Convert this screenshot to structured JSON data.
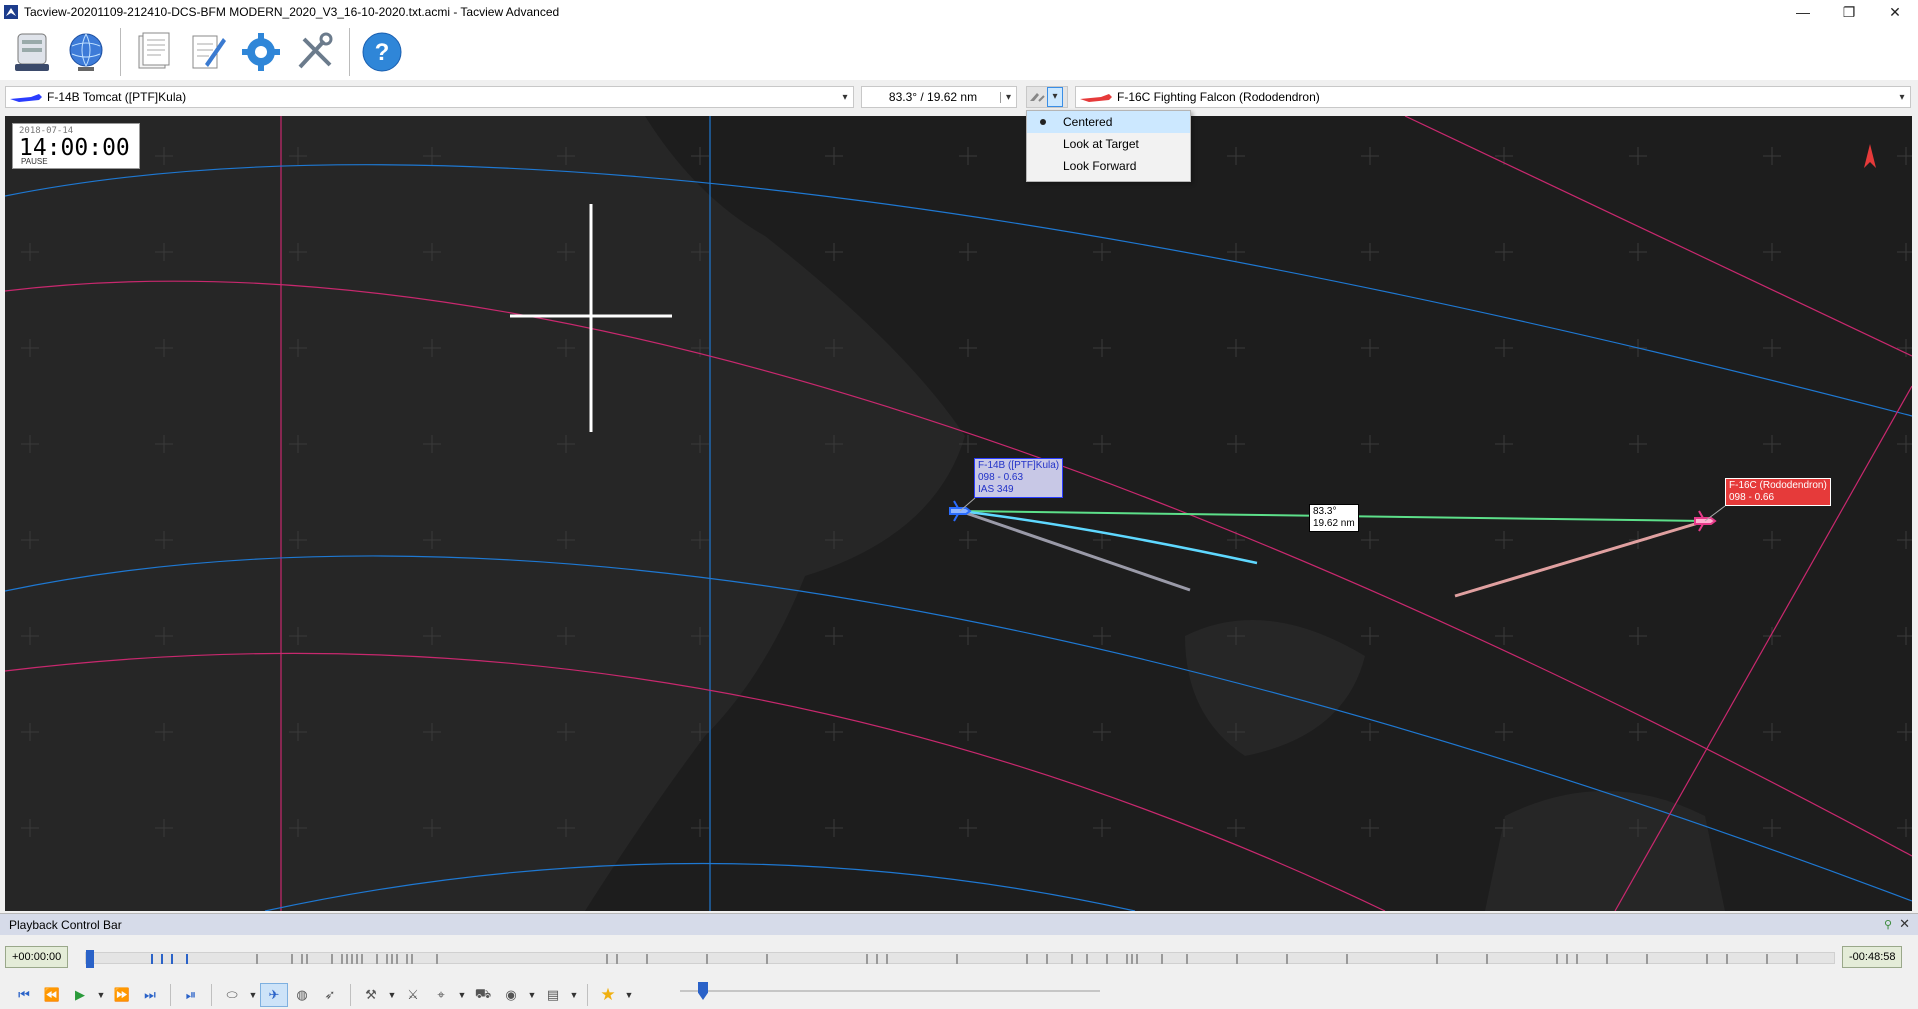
{
  "window": {
    "title": "Tacview-20201109-212410-DCS-BFM MODERN_2020_V3_16-10-2020.txt.acmi - Tacview Advanced",
    "minimize": "—",
    "restore": "❐",
    "close": "✕"
  },
  "toolbar": {
    "items": [
      "recorder-icon",
      "globe-icon",
      "documents-icon",
      "notepad-icon",
      "settings-gear-icon",
      "tools-icon",
      "help-icon"
    ]
  },
  "selectors": {
    "primary_object": "F-14B Tomcat ([PTF]Kula)",
    "bearing_range": "83.3° / 19.62 nm",
    "secondary_object": "F-16C Fighting Falcon (Rododendron)"
  },
  "camera_menu": {
    "items": [
      {
        "label": "Centered",
        "selected": true
      },
      {
        "label": "Look at Target",
        "selected": false
      },
      {
        "label": "Look Forward",
        "selected": false
      }
    ]
  },
  "clock": {
    "date": "2018-07-14",
    "time": "14:00:00",
    "state": "PAUSE"
  },
  "labels": {
    "f14": {
      "line1": "F-14B ([PTF]Kula)",
      "line2": "098 - 0.63",
      "line3": "IAS 349"
    },
    "f16": {
      "line1": "F-16C (Rododendron)",
      "line2": "098 - 0.66"
    },
    "range": {
      "line1": "83.3°",
      "line2": "19.62 nm"
    }
  },
  "colors": {
    "blue_coalition": "#2a3cff",
    "red_coalition": "#e63a3a",
    "grid_blue": "#1e78d2",
    "grid_magenta": "#c8286e",
    "los_line": "#5de08a",
    "trail_cyan": "#5fd8ff"
  },
  "playback": {
    "title": "Playback Control Bar",
    "start_time": "+00:00:00",
    "end_time": "-00:48:58",
    "progress": 0.0
  },
  "controls": {
    "buttons": [
      "skip-start-icon",
      "rewind-icon",
      "play-icon",
      "play-options-icon",
      "fast-forward-icon",
      "skip-end-icon",
      "frame-step-icon",
      "view-mode-icon",
      "aircraft-icon",
      "globe-small-icon",
      "missile-icon",
      "tools-small-icon",
      "weapon-icon",
      "helicopter-icon",
      "ground-unit-icon",
      "sphere-icon",
      "layers-icon",
      "bookmark-star-icon"
    ]
  }
}
